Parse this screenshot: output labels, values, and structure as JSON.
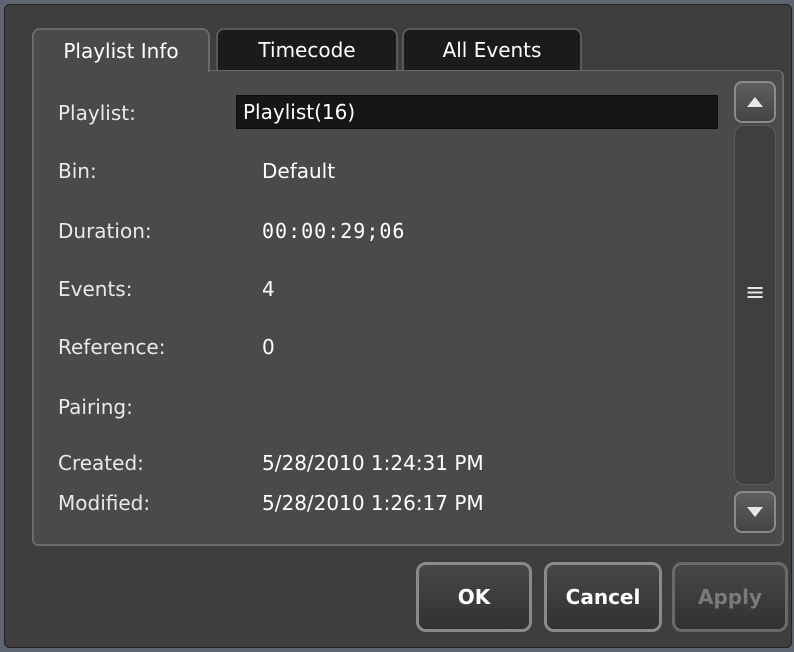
{
  "tabs": [
    {
      "label": "Playlist Info",
      "active": true
    },
    {
      "label": "Timecode",
      "active": false
    },
    {
      "label": "All Events",
      "active": false
    }
  ],
  "fields": {
    "playlist": {
      "label": "Playlist:",
      "value": "Playlist(16)"
    },
    "bin": {
      "label": "Bin:",
      "value": "Default"
    },
    "duration": {
      "label": "Duration:",
      "value": "00:00:29;06"
    },
    "events": {
      "label": "Events:",
      "value": "4"
    },
    "reference": {
      "label": "Reference:",
      "value": "0"
    },
    "pairing": {
      "label": "Pairing:",
      "value": ""
    },
    "created": {
      "label": "Created:",
      "value": "5/28/2010 1:24:31 PM"
    },
    "modified": {
      "label": "Modified:",
      "value": "5/28/2010 1:26:17 PM"
    }
  },
  "scrollbar": {
    "up_icon": "triangle-up-icon",
    "down_icon": "triangle-down-icon",
    "grip_icon": "grip-icon"
  },
  "buttons": {
    "ok": "OK",
    "cancel": "Cancel",
    "apply": "Apply"
  },
  "colors": {
    "background": "#3e3e3e",
    "panel": "#4a4a4a",
    "input": "#161616",
    "border": "#8a8a8a"
  }
}
